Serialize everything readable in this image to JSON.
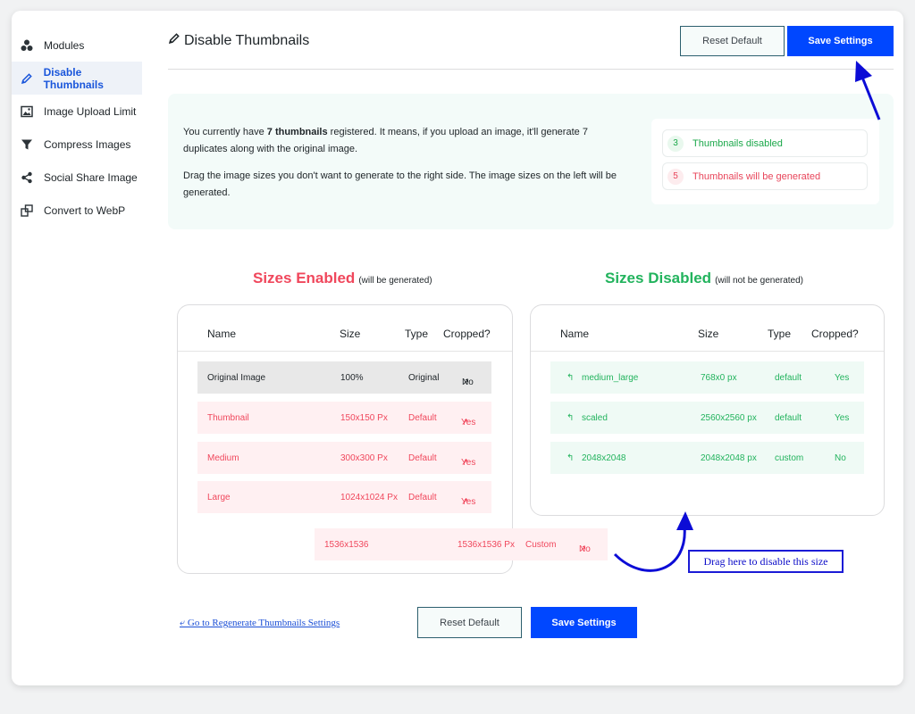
{
  "sidebar": {
    "items": [
      {
        "label": "Modules",
        "icon": "modules-icon"
      },
      {
        "label": "Disable Thumbnails",
        "icon": "pencil-icon",
        "active": true
      },
      {
        "label": "Image Upload Limit",
        "icon": "image-icon"
      },
      {
        "label": "Compress Images",
        "icon": "funnel-icon"
      },
      {
        "label": "Social Share Image",
        "icon": "share-icon"
      },
      {
        "label": "Convert to WebP",
        "icon": "convert-icon"
      }
    ]
  },
  "header": {
    "title": "Disable Thumbnails",
    "reset_label": "Reset Default",
    "save_label": "Save Settings"
  },
  "info": {
    "line1_pre": "You currently have ",
    "line1_bold": "7 thumbnails",
    "line1_post": " registered. It means, if you upload an image, it'll generate 7 duplicates along with the original image.",
    "line2": "Drag the image sizes you don't want to generate to the right side. The image sizes on the left will be generated.",
    "disabled_count": "3",
    "disabled_label": "Thumbnails disabled",
    "generated_count": "5",
    "generated_label": "Thumbnails will be generated"
  },
  "enabled": {
    "title": "Sizes Enabled",
    "subtitle": "(will be generated)",
    "columns": [
      "Name",
      "Size",
      "Type",
      "Cropped?"
    ],
    "rows": [
      {
        "name": "Original Image",
        "size": "100%",
        "type": "Original",
        "cropped": "No"
      },
      {
        "name": "Thumbnail",
        "size": "150x150 Px",
        "type": "Default",
        "cropped": "Yes"
      },
      {
        "name": "Medium",
        "size": "300x300 Px",
        "type": "Default",
        "cropped": "Yes"
      },
      {
        "name": "Large",
        "size": "1024x1024 Px",
        "type": "Default",
        "cropped": "Yes"
      }
    ],
    "dragging": {
      "name": "1536x1536",
      "size": "1536x1536 Px",
      "type": "Custom",
      "cropped": "No"
    }
  },
  "disabled": {
    "title": "Sizes Disabled",
    "subtitle": "(will not be generated)",
    "columns": [
      "Name",
      "Size",
      "Type",
      "Cropped?"
    ],
    "rows": [
      {
        "name": "medium_large",
        "size": "768x0 px",
        "type": "default",
        "cropped": "Yes"
      },
      {
        "name": "scaled",
        "size": "2560x2560 px",
        "type": "default",
        "cropped": "Yes"
      },
      {
        "name": "2048x2048",
        "size": "2048x2048 px",
        "type": "custom",
        "cropped": "No"
      }
    ]
  },
  "drag_hint": "Drag here  to disable this size",
  "footer": {
    "regen_link": "⤶ Go to Regenerate Thumbnails Settings",
    "reset_label": "Reset Default",
    "save_label": "Save Settings"
  },
  "colors": {
    "accent": "#0047ff",
    "enabled_red": "#f0475c",
    "disabled_green": "#22b35d"
  }
}
